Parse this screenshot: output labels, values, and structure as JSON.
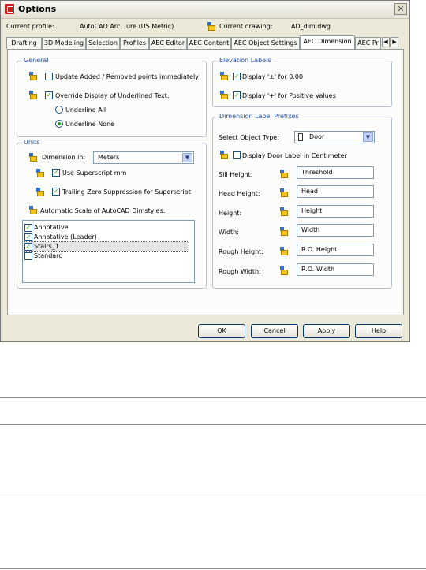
{
  "window": {
    "title": "Options",
    "close_label": "✕"
  },
  "profile": {
    "current_profile_label": "Current profile:",
    "current_profile_value": "AutoCAD Arc...ure (US Metric)",
    "current_drawing_label": "Current drawing:",
    "current_drawing_value": "AD_dim.dwg"
  },
  "tabs": [
    {
      "label": "Drafting"
    },
    {
      "label": "3D Modeling"
    },
    {
      "label": "Selection"
    },
    {
      "label": "Profiles"
    },
    {
      "label": "AEC Editor"
    },
    {
      "label": "AEC Content"
    },
    {
      "label": "AEC Object Settings"
    },
    {
      "label": "AEC Dimension"
    },
    {
      "label": "AEC Pr"
    }
  ],
  "tab_scroll": {
    "left": "◀",
    "right": "▶"
  },
  "general": {
    "label": "General",
    "update_added": {
      "label": "Update Added / Removed points immediately",
      "checked": false
    },
    "override_display": {
      "label": "Override Display of Underlined Text:",
      "checked": true
    },
    "underline_all": {
      "label": "Underline All",
      "selected": false
    },
    "underline_none": {
      "label": "Underline None",
      "selected": true
    }
  },
  "units": {
    "label": "Units",
    "dimension_in_label": "Dimension in:",
    "dimension_in_value": "Meters",
    "use_superscript": {
      "label": "Use Superscript mm",
      "checked": true
    },
    "trailing_zero": {
      "label": "Trailing Zero Suppression for Superscript",
      "checked": true
    },
    "auto_scale_label": "Automatic Scale of AutoCAD Dimstyles:",
    "dimstyles": [
      {
        "label": "Annotative",
        "checked": true
      },
      {
        "label": "Annotative (Leader)",
        "checked": true
      },
      {
        "label": "Stairs_1",
        "checked": true
      },
      {
        "label": "Standard",
        "checked": false
      }
    ]
  },
  "elevation": {
    "label": "Elevation Labels",
    "display_plusminus": {
      "label": "Display '±' for 0.00",
      "checked": true
    },
    "display_plus": {
      "label": "Display '+' for Positive Values",
      "checked": true
    }
  },
  "dimension_prefixes": {
    "label": "Dimension Label Prefixes",
    "select_object_type_label": "Select Object Type:",
    "select_object_type_value": "Door",
    "display_door_cm": {
      "label": "Display Door Label in Centimeter",
      "checked": false
    },
    "rows": [
      {
        "label": "Sill Height:",
        "value": "Threshold"
      },
      {
        "label": "Head Height:",
        "value": "Head"
      },
      {
        "label": "Height:",
        "value": "Height"
      },
      {
        "label": "Width:",
        "value": "Width"
      },
      {
        "label": "Rough Height:",
        "value": "R.O. Height"
      },
      {
        "label": "Rough Width:",
        "value": "R.O. Width"
      }
    ]
  },
  "buttons": {
    "ok": "OK",
    "cancel": "Cancel",
    "apply": "Apply",
    "help": "Help"
  }
}
